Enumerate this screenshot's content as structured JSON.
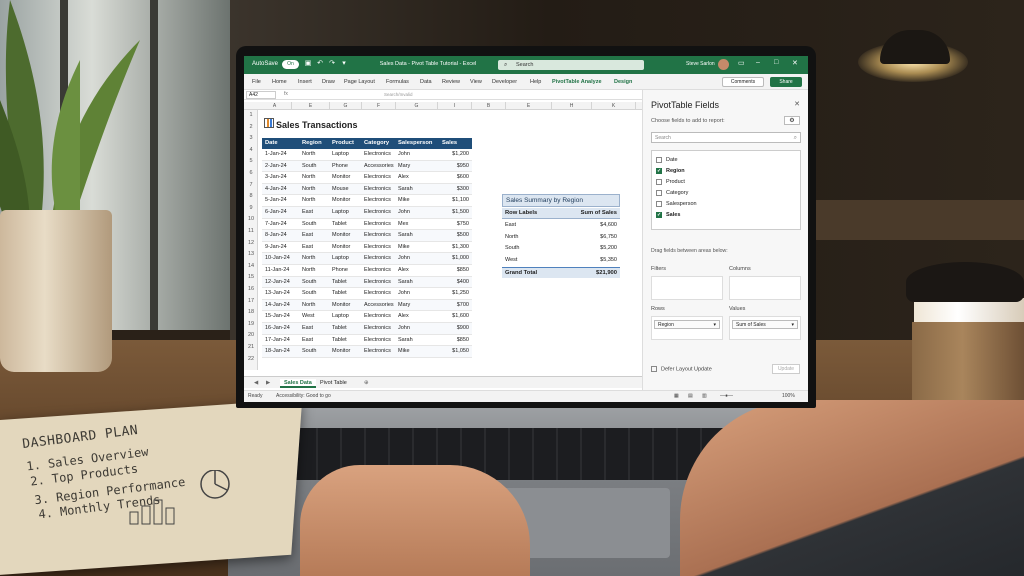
{
  "titlebar": {
    "autosave_label": "AutoSave",
    "autosave_state": "On",
    "document_title": "Sales Data - Pivot Table Tutorial - Excel",
    "search_placeholder": "Search",
    "user_name": "Steve Sarlon"
  },
  "ribbon": {
    "tabs": [
      "File",
      "Home",
      "Insert",
      "Draw",
      "Page Layout",
      "Formulas",
      "Data",
      "Review",
      "View",
      "Developer",
      "Help",
      "PivotTable Analyze",
      "Design"
    ],
    "comments_label": "Comments",
    "share_label": "Share"
  },
  "formula_bar": {
    "name_box": "A42",
    "fx_label": "fx",
    "input_text": "Search/Invalid"
  },
  "columns": [
    "A",
    "E",
    "G",
    "F",
    "G",
    "I",
    "B",
    "E",
    "H",
    "K"
  ],
  "rows": [
    "1",
    "2",
    "3",
    "4",
    "5",
    "6",
    "7",
    "8",
    "9",
    "10",
    "11",
    "12",
    "13",
    "14",
    "15",
    "16",
    "17",
    "18",
    "19",
    "20",
    "21",
    "22"
  ],
  "sheet": {
    "title": "Sales Transactions",
    "headers": [
      "Date",
      "Region",
      "Product",
      "Category",
      "Salesperson",
      "Sales"
    ],
    "data": [
      [
        "1-Jan-24",
        "North",
        "Laptop",
        "Electronics",
        "John",
        "$1,200"
      ],
      [
        "2-Jan-24",
        "South",
        "Phone",
        "Accessories",
        "Mary",
        "$950"
      ],
      [
        "3-Jan-24",
        "North",
        "Monitor",
        "Electronics",
        "Alex",
        "$600"
      ],
      [
        "4-Jan-24",
        "North",
        "Mouse",
        "Electronics",
        "Sarah",
        "$300"
      ],
      [
        "5-Jan-24",
        "North",
        "Monitor",
        "Electronics",
        "Mike",
        "$1,100"
      ],
      [
        "6-Jan-24",
        "East",
        "Laptop",
        "Electronics",
        "John",
        "$1,500"
      ],
      [
        "7-Jan-24",
        "South",
        "Tablet",
        "Electronics",
        "Mex",
        "$750"
      ],
      [
        "8-Jan-24",
        "East",
        "Monitor",
        "Electronics",
        "Sarah",
        "$500"
      ],
      [
        "9-Jan-24",
        "East",
        "Monitor",
        "Electronics",
        "Mike",
        "$1,300"
      ],
      [
        "10-Jan-24",
        "North",
        "Laptop",
        "Electronics",
        "John",
        "$1,000"
      ],
      [
        "11-Jan-24",
        "North",
        "Phone",
        "Electronics",
        "Alex",
        "$850"
      ],
      [
        "12-Jan-24",
        "South",
        "Tablet",
        "Electronics",
        "Sarah",
        "$400"
      ],
      [
        "13-Jan-24",
        "South",
        "Tablet",
        "Electronics",
        "John",
        "$1,250"
      ],
      [
        "14-Jan-24",
        "North",
        "Monitor",
        "Accessories",
        "Mary",
        "$700"
      ],
      [
        "15-Jan-24",
        "West",
        "Laptop",
        "Electronics",
        "Alex",
        "$1,600"
      ],
      [
        "16-Jan-24",
        "East",
        "Tablet",
        "Electronics",
        "John",
        "$900"
      ],
      [
        "17-Jan-24",
        "East",
        "Tablet",
        "Electronics",
        "Sarah",
        "$850"
      ],
      [
        "18-Jan-24",
        "South",
        "Monitor",
        "Electronics",
        "Mike",
        "$1,050"
      ]
    ]
  },
  "pivot": {
    "title": "Sales Summary by Region",
    "col1": "Row Labels",
    "col2": "Sum of Sales",
    "rows": [
      [
        "East",
        "$4,600"
      ],
      [
        "North",
        "$6,750"
      ],
      [
        "South",
        "$5,200"
      ],
      [
        "West",
        "$5,350"
      ]
    ],
    "total_label": "Grand Total",
    "total_value": "$21,900"
  },
  "sheet_tabs": [
    "Sales Data",
    "Pivot Table"
  ],
  "status": {
    "ready": "Ready",
    "accessibility": "Accessibility: Good to go",
    "zoom": "100%"
  },
  "panel": {
    "title": "PivotTable Fields",
    "subtitle": "Choose fields to add to report:",
    "search_placeholder": "Search",
    "fields": [
      {
        "name": "Date",
        "checked": false
      },
      {
        "name": "Region",
        "checked": true
      },
      {
        "name": "Product",
        "checked": false
      },
      {
        "name": "Category",
        "checked": false
      },
      {
        "name": "Salesperson",
        "checked": false
      },
      {
        "name": "Sales",
        "checked": true
      }
    ],
    "drag_label": "Drag fields between areas below:",
    "filters_label": "Filters",
    "columns_label": "Columns",
    "rows_label": "Rows",
    "values_label": "Values",
    "rows_value": "Region",
    "values_value": "Sum of Sales",
    "defer_label": "Defer Layout Update",
    "update_label": "Update"
  },
  "notebook": {
    "title": "DASHBOARD PLAN",
    "items": [
      "1. Sales Overview",
      "2. Top Products",
      "3. Region Performance",
      "4. Monthly Trends"
    ]
  }
}
